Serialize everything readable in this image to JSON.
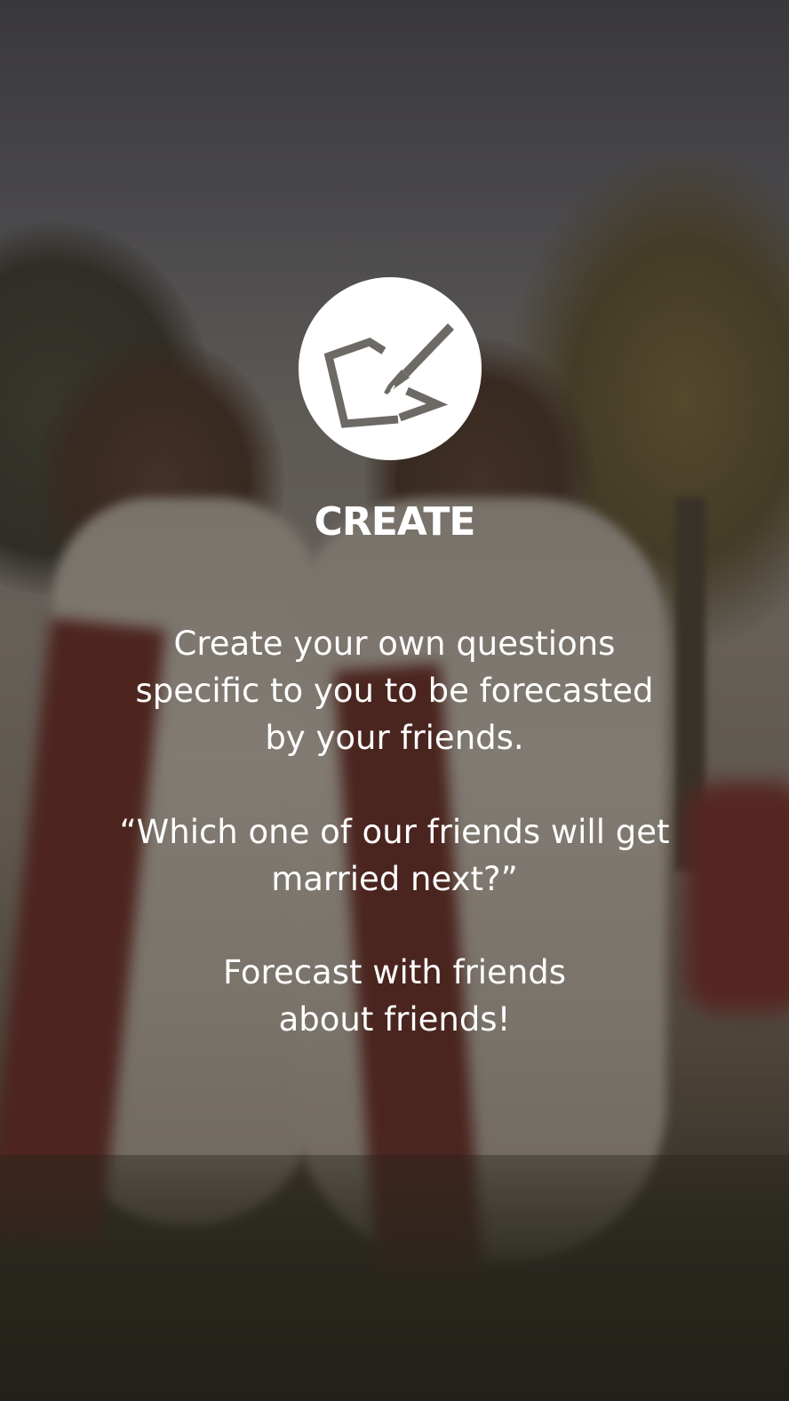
{
  "feature": {
    "icon": "create-edit-icon",
    "title": "CREATE"
  },
  "description": {
    "paragraph1": [
      "Create your own questions",
      "specific to you to be forecasted",
      "by your friends."
    ],
    "quote": [
      "“Which one of our friends will get",
      "married next?”"
    ],
    "tagline": [
      "Forecast with friends",
      "about friends!"
    ]
  },
  "colors": {
    "text": "#ffffff",
    "icon_circle": "#ffffff",
    "icon_stroke": "#6d6a66"
  }
}
